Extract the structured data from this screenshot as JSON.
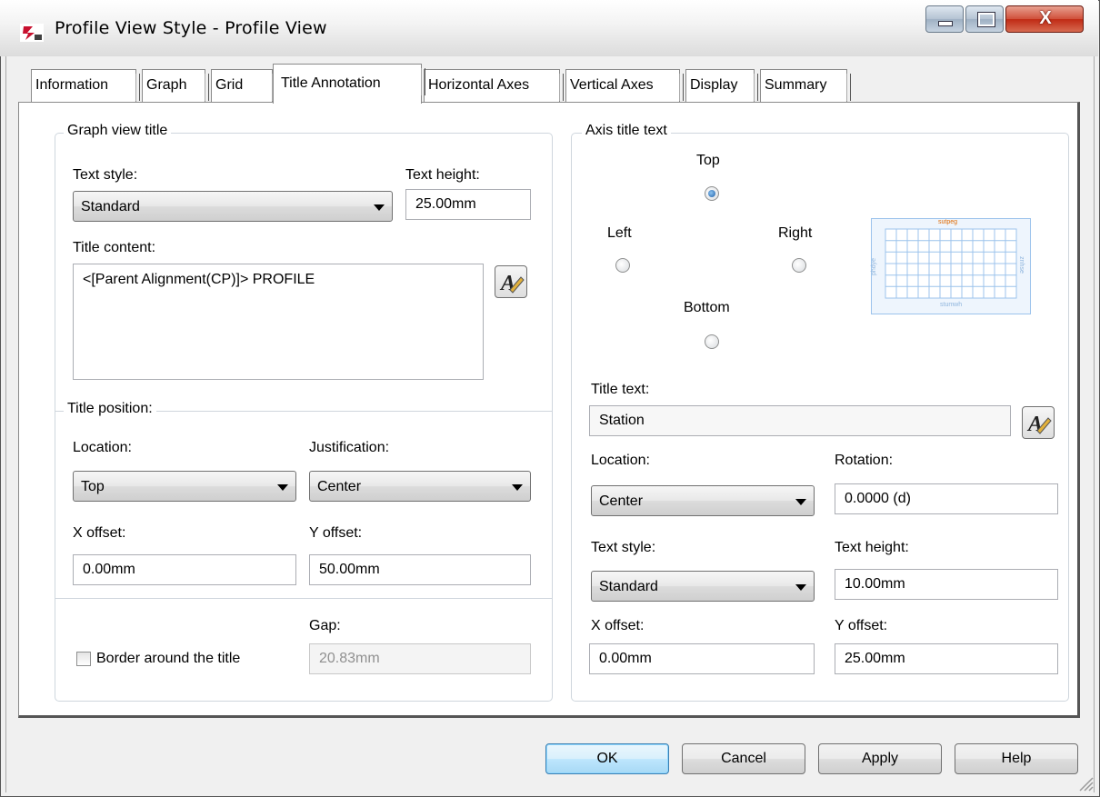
{
  "window": {
    "title": "Profile View Style - Profile View",
    "close_label": "X"
  },
  "tabs": [
    "Information",
    "Graph",
    "Grid",
    "Title Annotation",
    "Horizontal Axes",
    "Vertical Axes",
    "Display",
    "Summary"
  ],
  "active_tab": "Title Annotation",
  "graph_view_title": {
    "group_label": "Graph view title",
    "text_style_label": "Text style:",
    "text_style_value": "Standard",
    "text_height_label": "Text height:",
    "text_height_value": "25.00mm",
    "title_content_label": "Title content:",
    "title_content_value": "<[Parent Alignment(CP)]> PROFILE"
  },
  "title_position": {
    "group_label": "Title position:",
    "location_label": "Location:",
    "location_value": "Top",
    "justification_label": "Justification:",
    "justification_value": "Center",
    "x_offset_label": "X offset:",
    "x_offset_value": "0.00mm",
    "y_offset_label": "Y offset:",
    "y_offset_value": "50.00mm",
    "gap_label": "Gap:",
    "gap_value": "20.83mm",
    "border_label": "Border around the title",
    "border_checked": false
  },
  "axis_title_text": {
    "group_label": "Axis title text",
    "positions": {
      "top": "Top",
      "left": "Left",
      "right": "Right",
      "bottom": "Bottom"
    },
    "selected_position": "Top",
    "preview_labels": {
      "top": "sutpeg",
      "bottom": "stumwh",
      "left": "phdye",
      "right": "znhse"
    },
    "title_text_label": "Title text:",
    "title_text_value": "Station",
    "location_label": "Location:",
    "location_value": "Center",
    "rotation_label": "Rotation:",
    "rotation_value": "0.0000 (d)",
    "text_style_label": "Text style:",
    "text_style_value": "Standard",
    "text_height_label": "Text height:",
    "text_height_value": "10.00mm",
    "x_offset_label": "X offset:",
    "x_offset_value": "0.00mm",
    "y_offset_label": "Y offset:",
    "y_offset_value": "25.00mm"
  },
  "buttons": {
    "ok": "OK",
    "cancel": "Cancel",
    "apply": "Apply",
    "help": "Help"
  },
  "colors": {
    "accent": "#3c7fb1",
    "preview_grid": "#9cc3ec",
    "preview_title": "#e06a00"
  }
}
